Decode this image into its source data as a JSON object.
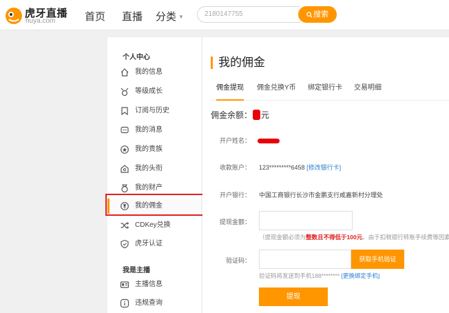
{
  "colors": {
    "accent": "#ff9600",
    "link": "#2b7fd1",
    "warning": "#e02020",
    "redaction": "#e8000b"
  },
  "header": {
    "logo_cn": "虎牙直播",
    "logo_en": "huya.com",
    "nav": [
      "首页",
      "直播",
      "分类"
    ],
    "search_placeholder": "2180147755",
    "search_button": "搜索"
  },
  "sidebar": {
    "section1_title": "个人中心",
    "section1_items": [
      {
        "label": "我的信息",
        "icon": "home-icon"
      },
      {
        "label": "等级成长",
        "icon": "level-icon"
      },
      {
        "label": "订阅与历史",
        "icon": "bookmark-icon"
      },
      {
        "label": "我的消息",
        "icon": "message-icon"
      },
      {
        "label": "我的贵族",
        "icon": "noble-icon"
      },
      {
        "label": "我的头衔",
        "icon": "title-icon"
      },
      {
        "label": "我的财产",
        "icon": "wallet-icon"
      },
      {
        "label": "我的佣金",
        "icon": "commission-icon"
      },
      {
        "label": "CDKey兑换",
        "icon": "shuffle-icon"
      },
      {
        "label": "虎牙认证",
        "icon": "shield-icon"
      }
    ],
    "section2_title": "我是主播",
    "section2_items": [
      {
        "label": "主播信息",
        "icon": "id-card-icon"
      },
      {
        "label": "违规查询",
        "icon": "info-icon"
      }
    ],
    "active_index": 7
  },
  "main": {
    "title": "我的佣金",
    "tabs": [
      "佣金提现",
      "佣金兑换Y币",
      "绑定银行卡",
      "交易明细"
    ],
    "active_tab": 0,
    "balance_prefix": "佣金余额：",
    "balance_suffix": "元",
    "form": {
      "account_name_label": "开户姓名：",
      "account_no_label": "收款账户：",
      "account_no_value": "123*********6458",
      "account_no_link": "[修改银行卡]",
      "bank_label": "开户银行：",
      "bank_value": "中国工商银行长沙市金鹏支行咸嘉新村分理处",
      "amount_label": "提现金额：",
      "amount_hint_before": "（提现金额必须为",
      "amount_hint_warn": "整数且不得低于100元",
      "amount_hint_after": "。由于扣税银行转账手续费等因素",
      "code_label": "验证码：",
      "code_button": "获取手机验证",
      "phone_note": "验证码将发送到手机188********",
      "phone_link": "[更换绑定手机]",
      "submit": "提现"
    }
  }
}
